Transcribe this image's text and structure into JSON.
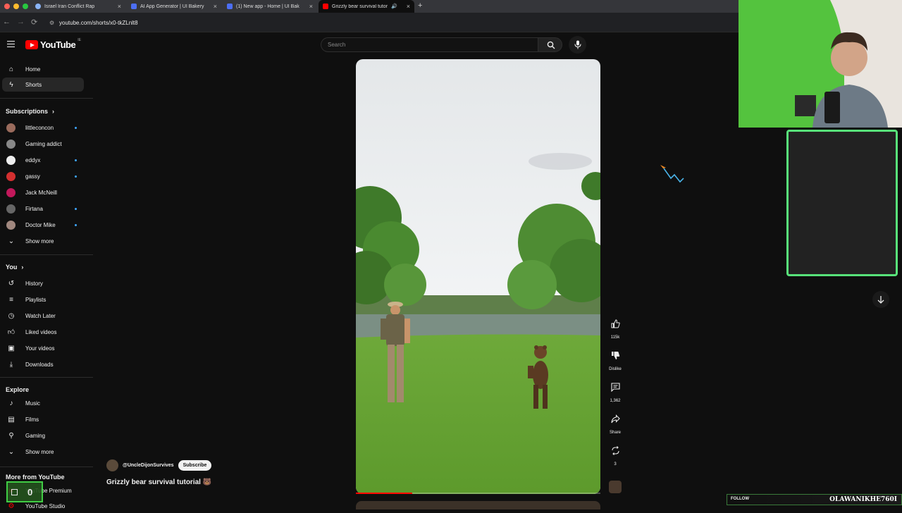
{
  "browser": {
    "tabs": [
      {
        "label": "Israel Iran Conflict Rap",
        "favicon_color": "#8ab4f8"
      },
      {
        "label": "AI App Generator | UI Bakery",
        "favicon_color": "#4c6ef5"
      },
      {
        "label": "(1) New app - Home | UI Bak",
        "favicon_color": "#4c6ef5"
      },
      {
        "label": "Grizzly bear survival tutor",
        "favicon_color": "#ff0000"
      }
    ],
    "tab_close": "×",
    "new_tab": "+",
    "url": "youtube.com/shorts/x0-tkZLnlt8",
    "back": "←",
    "forward": "→",
    "reload": "⟳"
  },
  "header": {
    "logo_text": "YouTube",
    "logo_suffix": "IE",
    "search_placeholder": "Search"
  },
  "sidebar": {
    "main": [
      {
        "label": "Home",
        "icon": "home-icon"
      },
      {
        "label": "Shorts",
        "icon": "shorts-icon",
        "selected": true
      }
    ],
    "subscriptions_title": "Subscriptions",
    "subscriptions": [
      {
        "label": "littleconcon",
        "live": true,
        "color": "#9a6b5c"
      },
      {
        "label": "Gaming addict",
        "live": false,
        "color": "#888"
      },
      {
        "label": "eddyx",
        "live": true,
        "color": "#eee"
      },
      {
        "label": "gassy",
        "live": true,
        "color": "#d32f2f"
      },
      {
        "label": "Jack McNeill",
        "live": false,
        "color": "#c2185b"
      },
      {
        "label": "Firtana",
        "live": true,
        "color": "#666"
      },
      {
        "label": "Doctor Mike",
        "live": true,
        "color": "#a1887f"
      }
    ],
    "show_more": "Show more",
    "you_title": "You",
    "you": [
      {
        "label": "History",
        "icon": "history-icon"
      },
      {
        "label": "Playlists",
        "icon": "playlists-icon"
      },
      {
        "label": "Watch Later",
        "icon": "watch-later-icon"
      },
      {
        "label": "Liked videos",
        "icon": "like-icon"
      },
      {
        "label": "Your videos",
        "icon": "your-videos-icon"
      },
      {
        "label": "Downloads",
        "icon": "download-icon"
      }
    ],
    "explore_title": "Explore",
    "explore": [
      {
        "label": "Music",
        "icon": "music-icon"
      },
      {
        "label": "Films",
        "icon": "films-icon"
      },
      {
        "label": "Gaming",
        "icon": "gaming-icon"
      }
    ],
    "explore_show_more": "Show more",
    "more_title": "More from YouTube",
    "more": [
      {
        "label": "YouTube Premium"
      },
      {
        "label": "YouTube Studio"
      }
    ]
  },
  "video": {
    "progress": 0.23,
    "channel": "@UncleDijonSurvives",
    "subscribe": "Subscribe",
    "title": "Grizzly bear survival tutorial 🐻"
  },
  "actions": {
    "likes": "115k",
    "dislike": "Dislike",
    "comments": "1,362",
    "share": "Share",
    "remix": "3"
  },
  "overlay": {
    "follow": "FOLLOW",
    "name": "OLAWANIKHE760I",
    "rec_counter": "0"
  }
}
